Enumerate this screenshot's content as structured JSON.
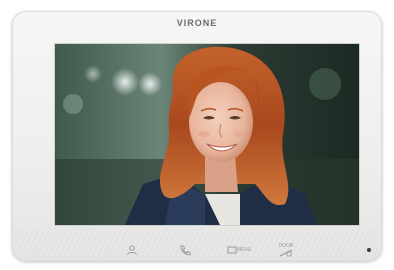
{
  "device": {
    "brand": "VIRONE",
    "accent_color": "#f3f3f1"
  },
  "screen": {
    "content": "portrait-photo"
  },
  "controls": [
    {
      "name": "user-icon"
    },
    {
      "name": "phone-icon"
    },
    {
      "name": "menu-icon",
      "label": "MENU"
    },
    {
      "name": "door-open-icon",
      "label": "DOOR"
    }
  ]
}
